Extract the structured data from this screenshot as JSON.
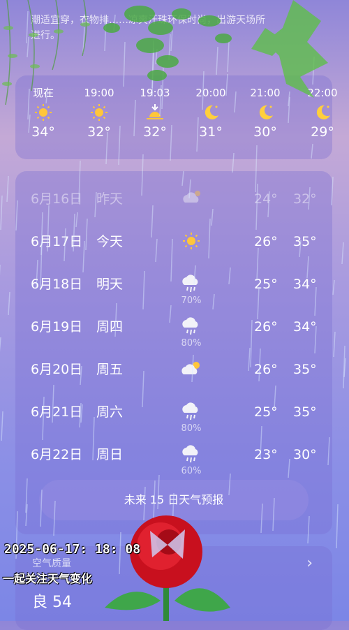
{
  "tip": "潮适宜穿，衣物排……凉爽汗珠环保时尚，出游天场所进行。",
  "hourly": [
    {
      "time": "现在",
      "icon": "sun-icon",
      "temp": "34°"
    },
    {
      "time": "19:00",
      "icon": "sun-icon",
      "temp": "32°"
    },
    {
      "time": "19:03",
      "icon": "sunset-icon",
      "temp": "32°"
    },
    {
      "time": "20:00",
      "icon": "moon-icon",
      "temp": "31°"
    },
    {
      "time": "21:00",
      "icon": "moon-icon",
      "temp": "30°"
    },
    {
      "time": "22:00",
      "icon": "moon-icon",
      "temp": "29°"
    }
  ],
  "daily": [
    {
      "date": "6月16日",
      "day": "昨天",
      "icon": "cloudy-icon",
      "pct": "",
      "lo": "24°",
      "hi": "32°",
      "past": true
    },
    {
      "date": "6月17日",
      "day": "今天",
      "icon": "sun-icon",
      "pct": "",
      "lo": "26°",
      "hi": "35°",
      "past": false
    },
    {
      "date": "6月18日",
      "day": "明天",
      "icon": "rain-icon",
      "pct": "70%",
      "lo": "25°",
      "hi": "34°",
      "past": false
    },
    {
      "date": "6月19日",
      "day": "周四",
      "icon": "rain-icon",
      "pct": "80%",
      "lo": "26°",
      "hi": "34°",
      "past": false
    },
    {
      "date": "6月20日",
      "day": "周五",
      "icon": "partly-cloudy-icon",
      "pct": "",
      "lo": "26°",
      "hi": "35°",
      "past": false
    },
    {
      "date": "6月21日",
      "day": "周六",
      "icon": "rain-icon",
      "pct": "80%",
      "lo": "25°",
      "hi": "35°",
      "past": false
    },
    {
      "date": "6月22日",
      "day": "周日",
      "icon": "rain-icon",
      "pct": "60%",
      "lo": "23°",
      "hi": "30°",
      "past": false
    }
  ],
  "forecast_button": "未来 15 日天气预报",
  "air_quality": {
    "title": "空气质量",
    "value": "良 54"
  },
  "overlay": {
    "timestamp": "2025-06-17: 18: 08",
    "caption": "一起关注天气变化"
  },
  "colors": {
    "sun": "#ffc63a",
    "moon": "#ffcf3d",
    "leaf": "#3fa64a",
    "rose": "#c8101e"
  }
}
